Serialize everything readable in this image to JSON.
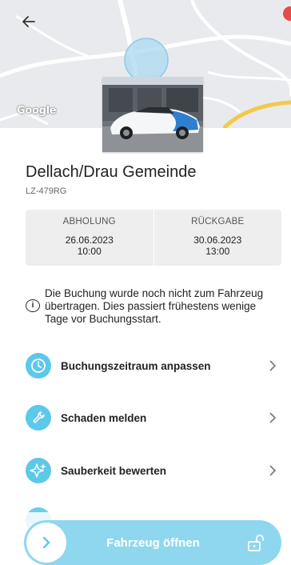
{
  "map": {
    "attribution": "Google"
  },
  "vehicle": {
    "location_name": "Dellach/Drau Gemeinde",
    "plate": "LZ-479RG"
  },
  "booking": {
    "pickup_label": "ABHOLUNG",
    "pickup_date": "26.06.2023",
    "pickup_time": "10:00",
    "return_label": "RÜCKGABE",
    "return_date": "30.06.2023",
    "return_time": "13:00"
  },
  "info_message": "Die Buchung wurde noch nicht zum Fahrzeug übertragen. Dies passiert frühestens wenige Tage vor Buchungsstart.",
  "actions": [
    {
      "label": "Buchungszeitraum anpassen",
      "icon": "clock-icon"
    },
    {
      "label": "Schaden melden",
      "icon": "wrench-icon"
    },
    {
      "label": "Sauberkeit bewerten",
      "icon": "sparkle-icon"
    }
  ],
  "primary_action": {
    "label": "Fahrzeug öffnen",
    "icon": "unlock-icon"
  },
  "colors": {
    "accent": "#5cc8ea",
    "accent_light": "#8fd7ee"
  }
}
